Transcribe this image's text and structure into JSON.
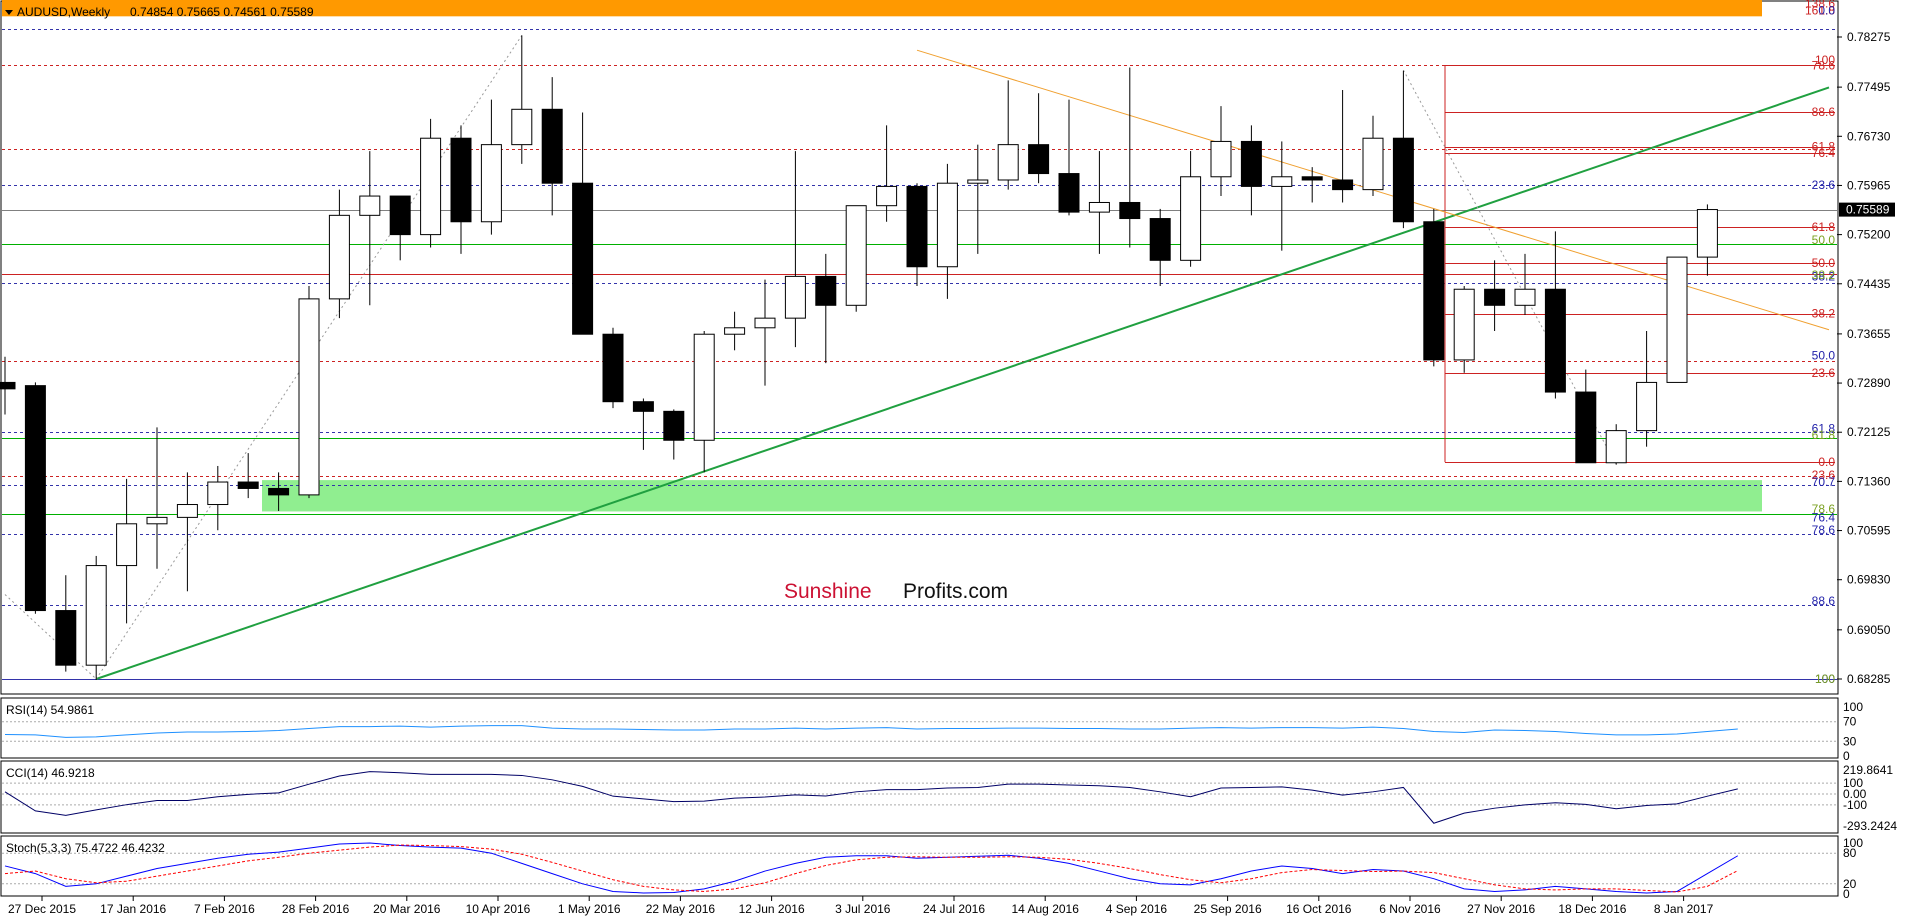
{
  "chart_data": [
    {
      "type": "candlestick",
      "symbol_header": {
        "symbol": "AUDUSD,Weekly",
        "ohlc": "0.74854 0.75665 0.74561 0.75589"
      },
      "current_price": "0.75589",
      "y_ticks": [
        "0.78275",
        "0.77495",
        "0.76730",
        "0.75965",
        "0.75200",
        "0.74435",
        "0.73655",
        "0.72890",
        "0.72125",
        "0.71360",
        "0.70595",
        "0.69830",
        "0.69050",
        "0.68285"
      ],
      "x_labels": [
        "27 Dec 2015",
        "17 Jan 2016",
        "7 Feb 2016",
        "28 Feb 2016",
        "20 Mar 2016",
        "10 Apr 2016",
        "1 May 2016",
        "22 May 2016",
        "12 Jun 2016",
        "3 Jul 2016",
        "24 Jul 2016",
        "14 Aug 2016",
        "4 Sep 2016",
        "25 Sep 2016",
        "16 Oct 2016",
        "6 Nov 2016",
        "27 Nov 2016",
        "18 Dec 2016",
        "8 Jan 2017"
      ],
      "watermark": {
        "part1": "Sunshine",
        "part2": "Profits.com"
      },
      "candles": [
        {
          "o": 0.729,
          "h": 0.733,
          "l": 0.724,
          "c": 0.728
        },
        {
          "o": 0.7285,
          "h": 0.729,
          "l": 0.693,
          "c": 0.6935
        },
        {
          "o": 0.6935,
          "h": 0.699,
          "l": 0.684,
          "c": 0.685
        },
        {
          "o": 0.685,
          "h": 0.702,
          "l": 0.6827,
          "c": 0.7005
        },
        {
          "o": 0.7005,
          "h": 0.714,
          "l": 0.6915,
          "c": 0.707
        },
        {
          "o": 0.707,
          "h": 0.722,
          "l": 0.7,
          "c": 0.708
        },
        {
          "o": 0.708,
          "h": 0.715,
          "l": 0.6965,
          "c": 0.71
        },
        {
          "o": 0.71,
          "h": 0.716,
          "l": 0.706,
          "c": 0.7135
        },
        {
          "o": 0.7135,
          "h": 0.718,
          "l": 0.711,
          "c": 0.7125
        },
        {
          "o": 0.7125,
          "h": 0.715,
          "l": 0.709,
          "c": 0.7115
        },
        {
          "o": 0.7115,
          "h": 0.744,
          "l": 0.711,
          "c": 0.742
        },
        {
          "o": 0.742,
          "h": 0.759,
          "l": 0.739,
          "c": 0.755
        },
        {
          "o": 0.755,
          "h": 0.765,
          "l": 0.741,
          "c": 0.758
        },
        {
          "o": 0.758,
          "h": 0.758,
          "l": 0.748,
          "c": 0.752
        },
        {
          "o": 0.752,
          "h": 0.77,
          "l": 0.75,
          "c": 0.767
        },
        {
          "o": 0.767,
          "h": 0.769,
          "l": 0.749,
          "c": 0.754
        },
        {
          "o": 0.754,
          "h": 0.773,
          "l": 0.752,
          "c": 0.766
        },
        {
          "o": 0.766,
          "h": 0.783,
          "l": 0.763,
          "c": 0.7715
        },
        {
          "o": 0.7715,
          "h": 0.7765,
          "l": 0.755,
          "c": 0.76
        },
        {
          "o": 0.76,
          "h": 0.771,
          "l": 0.738,
          "c": 0.7365
        },
        {
          "o": 0.7365,
          "h": 0.7375,
          "l": 0.725,
          "c": 0.726
        },
        {
          "o": 0.726,
          "h": 0.7265,
          "l": 0.7185,
          "c": 0.7245
        },
        {
          "o": 0.7245,
          "h": 0.7248,
          "l": 0.717,
          "c": 0.72
        },
        {
          "o": 0.72,
          "h": 0.737,
          "l": 0.715,
          "c": 0.7365
        },
        {
          "o": 0.7365,
          "h": 0.74,
          "l": 0.734,
          "c": 0.7375
        },
        {
          "o": 0.7375,
          "h": 0.745,
          "l": 0.7285,
          "c": 0.739
        },
        {
          "o": 0.739,
          "h": 0.765,
          "l": 0.7345,
          "c": 0.7455
        },
        {
          "o": 0.7455,
          "h": 0.749,
          "l": 0.732,
          "c": 0.741
        },
        {
          "o": 0.741,
          "h": 0.756,
          "l": 0.74,
          "c": 0.7565
        },
        {
          "o": 0.7565,
          "h": 0.769,
          "l": 0.754,
          "c": 0.7595
        },
        {
          "o": 0.7595,
          "h": 0.76,
          "l": 0.744,
          "c": 0.747
        },
        {
          "o": 0.747,
          "h": 0.763,
          "l": 0.742,
          "c": 0.76
        },
        {
          "o": 0.76,
          "h": 0.766,
          "l": 0.749,
          "c": 0.7605
        },
        {
          "o": 0.7605,
          "h": 0.776,
          "l": 0.759,
          "c": 0.766
        },
        {
          "o": 0.766,
          "h": 0.774,
          "l": 0.76,
          "c": 0.7615
        },
        {
          "o": 0.7615,
          "h": 0.773,
          "l": 0.755,
          "c": 0.7555
        },
        {
          "o": 0.7555,
          "h": 0.765,
          "l": 0.749,
          "c": 0.757
        },
        {
          "o": 0.757,
          "h": 0.778,
          "l": 0.75,
          "c": 0.7545
        },
        {
          "o": 0.7545,
          "h": 0.756,
          "l": 0.744,
          "c": 0.748
        },
        {
          "o": 0.748,
          "h": 0.765,
          "l": 0.747,
          "c": 0.761
        },
        {
          "o": 0.761,
          "h": 0.772,
          "l": 0.758,
          "c": 0.7665
        },
        {
          "o": 0.7665,
          "h": 0.769,
          "l": 0.755,
          "c": 0.7595
        },
        {
          "o": 0.7595,
          "h": 0.7665,
          "l": 0.7495,
          "c": 0.761
        },
        {
          "o": 0.761,
          "h": 0.7625,
          "l": 0.757,
          "c": 0.7605
        },
        {
          "o": 0.7605,
          "h": 0.7745,
          "l": 0.757,
          "c": 0.759
        },
        {
          "o": 0.759,
          "h": 0.7705,
          "l": 0.758,
          "c": 0.767
        },
        {
          "o": 0.767,
          "h": 0.7775,
          "l": 0.753,
          "c": 0.754
        },
        {
          "o": 0.754,
          "h": 0.756,
          "l": 0.7315,
          "c": 0.7325
        },
        {
          "o": 0.7325,
          "h": 0.744,
          "l": 0.7305,
          "c": 0.7435
        },
        {
          "o": 0.7435,
          "h": 0.748,
          "l": 0.737,
          "c": 0.741
        },
        {
          "o": 0.741,
          "h": 0.749,
          "l": 0.7395,
          "c": 0.7435
        },
        {
          "o": 0.7435,
          "h": 0.7525,
          "l": 0.7265,
          "c": 0.7275
        },
        {
          "o": 0.7275,
          "h": 0.731,
          "l": 0.7165,
          "c": 0.7165
        },
        {
          "o": 0.7165,
          "h": 0.7225,
          "l": 0.7162,
          "c": 0.7215
        },
        {
          "o": 0.7215,
          "h": 0.737,
          "l": 0.719,
          "c": 0.729
        },
        {
          "o": 0.729,
          "h": 0.7485,
          "l": 0.729,
          "c": 0.7485
        },
        {
          "o": 0.7485,
          "h": 0.7567,
          "l": 0.7456,
          "c": 0.7559
        }
      ],
      "levels": [
        {
          "price": 0.75589,
          "color": "#808080",
          "style": "solid"
        },
        {
          "price": 0.784,
          "color": "#3333aa",
          "style": "dashed"
        },
        {
          "price": 0.7784,
          "color": "#cc2222",
          "style": "dashed"
        },
        {
          "price": 0.7653,
          "color": "#cc2222",
          "style": "dashed"
        },
        {
          "price": 0.75975,
          "color": "#3333aa",
          "style": "dashed"
        },
        {
          "price": 0.7505,
          "color": "#00b000",
          "style": "solid"
        },
        {
          "price": 0.7459,
          "color": "#cc2222",
          "style": "solid"
        },
        {
          "price": 0.7444,
          "color": "#3333aa",
          "style": "dashed"
        },
        {
          "price": 0.7323,
          "color": "#cc2222",
          "style": "dashed"
        },
        {
          "price": 0.72125,
          "color": "#3333aa",
          "style": "dashed"
        },
        {
          "price": 0.7204,
          "color": "#00b000",
          "style": "solid"
        },
        {
          "price": 0.7145,
          "color": "#cc2222",
          "style": "dashed"
        },
        {
          "price": 0.7131,
          "color": "#3333aa",
          "style": "dashed"
        },
        {
          "price": 0.7086,
          "color": "#00b000",
          "style": "solid"
        },
        {
          "price": 0.7054,
          "color": "#3333aa",
          "style": "dashed"
        },
        {
          "price": 0.6943,
          "color": "#3333aa",
          "style": "dashed"
        },
        {
          "price": 0.68285,
          "color": "#3333aa",
          "style": "solid"
        }
      ],
      "fib_levels_red": [
        "0.0",
        "23.6",
        "38.2",
        "50.0",
        "61.8",
        "76.4",
        "78.6",
        "88.6",
        "100",
        "123.6",
        "161.8"
      ],
      "fib_labels_red": [
        {
          "text": "138.6",
          "price": 0.788
        },
        {
          "text": "161.8",
          "price": 0.7869
        },
        {
          "text": "100",
          "price": 0.7792
        },
        {
          "text": "78.6",
          "price": 0.7783
        },
        {
          "text": "88.6",
          "price": 0.7711
        },
        {
          "text": "61.8",
          "price": 0.7657
        },
        {
          "text": "76.4",
          "price": 0.7647
        },
        {
          "text": "61.8",
          "price": 0.7532
        },
        {
          "text": "50.0",
          "price": 0.7476
        },
        {
          "text": "38.2",
          "price": 0.7397
        },
        {
          "text": "23.6",
          "price": 0.7305
        },
        {
          "text": "0.0",
          "price": 0.7166
        },
        {
          "text": "23.6",
          "price": 0.7146
        }
      ],
      "fib_labels_blue": [
        {
          "text": "0.0",
          "price": 0.7869
        },
        {
          "text": "23.6",
          "price": 0.7597
        },
        {
          "text": "38.2",
          "price": 0.7455
        },
        {
          "text": "50.0",
          "price": 0.7332
        },
        {
          "text": "61.8",
          "price": 0.7218
        },
        {
          "text": "70.7",
          "price": 0.7135
        },
        {
          "text": "76.4",
          "price": 0.708
        },
        {
          "text": "78.6",
          "price": 0.706
        },
        {
          "text": "88.6",
          "price": 0.695
        },
        {
          "text": "100",
          "price": 0.68285
        }
      ],
      "fib_labels_green": [
        {
          "text": "50.0",
          "price": 0.7512
        },
        {
          "text": "38.2",
          "price": 0.7457
        },
        {
          "text": "61.8",
          "price": 0.7208
        },
        {
          "text": "78.6",
          "price": 0.7093
        },
        {
          "text": "100",
          "price": 0.68285
        }
      ],
      "resistance_zone": {
        "top": 0.7888,
        "bottom": 0.7869,
        "color": "#ff9900"
      },
      "support_zone": {
        "top": 0.7138,
        "bottom": 0.7111,
        "color": "#90ee90"
      },
      "trendlines": [
        {
          "color": "#20a040",
          "from": {
            "i": 3,
            "p": 0.68285
          },
          "to": {
            "i": 60,
            "p": 0.7749
          }
        },
        {
          "color": "#f0a030",
          "from": {
            "i": 30,
            "p": 0.7807
          },
          "to": {
            "i": 60,
            "p": 0.7372
          }
        }
      ]
    },
    {
      "type": "line",
      "label": "RSI(14) 54.9861",
      "y_ticks": [
        "100",
        "70",
        "30",
        "0"
      ],
      "ylim": [
        0,
        100
      ],
      "values": [
        44,
        43,
        38,
        39,
        43,
        47,
        49,
        49,
        50,
        52,
        56,
        60,
        60,
        61,
        59,
        61,
        62,
        62,
        57,
        55,
        55,
        54,
        53,
        53,
        55,
        55,
        57,
        55,
        57,
        58,
        55,
        56,
        56,
        57,
        57,
        56,
        56,
        55,
        55,
        57,
        58,
        57,
        58,
        58,
        57,
        59,
        56,
        50,
        48,
        53,
        52,
        50,
        46,
        43,
        43,
        45,
        50,
        55
      ]
    },
    {
      "type": "line",
      "label": "CCI(14) 46.9218",
      "y_ticks": [
        "219.8641",
        "100",
        "0.00",
        "-100",
        "-293.2424"
      ],
      "ylim": [
        -293.2424,
        219.8641
      ],
      "values": [
        20,
        -155,
        -196,
        -145,
        -98,
        -60,
        -60,
        -25,
        -3,
        10,
        90,
        165,
        205,
        195,
        180,
        180,
        180,
        170,
        130,
        70,
        -20,
        -45,
        -70,
        -65,
        -38,
        -28,
        -8,
        -18,
        20,
        40,
        40,
        55,
        60,
        90,
        90,
        82,
        75,
        60,
        20,
        -25,
        55,
        60,
        65,
        35,
        -10,
        20,
        60,
        -268,
        -175,
        -130,
        -100,
        -80,
        -95,
        -135,
        -105,
        -90,
        -20,
        47
      ]
    },
    {
      "type": "line",
      "label": "Stoch(5,3,3) 75.4722 46.4232",
      "y_ticks": [
        "100",
        "80",
        "20",
        "0"
      ],
      "ylim": [
        0,
        100
      ],
      "series": [
        {
          "name": "Stoch main",
          "color": "#0000ff",
          "values": [
            55,
            40,
            15,
            20,
            35,
            50,
            60,
            70,
            78,
            82,
            90,
            98,
            100,
            95,
            92,
            90,
            80,
            60,
            40,
            20,
            5,
            2,
            3,
            10,
            25,
            45,
            60,
            72,
            75,
            75,
            70,
            72,
            74,
            76,
            70,
            60,
            45,
            30,
            20,
            18,
            30,
            45,
            55,
            50,
            40,
            48,
            45,
            30,
            10,
            5,
            8,
            15,
            10,
            5,
            2,
            5,
            40,
            75
          ]
        },
        {
          "name": "Stoch signal",
          "color": "#ff0000",
          "values": [
            40,
            45,
            30,
            22,
            25,
            35,
            45,
            55,
            65,
            72,
            80,
            86,
            92,
            96,
            95,
            93,
            88,
            78,
            62,
            45,
            28,
            15,
            8,
            5,
            10,
            22,
            40,
            56,
            67,
            72,
            73,
            72,
            72,
            73,
            72,
            68,
            60,
            50,
            38,
            28,
            22,
            30,
            42,
            48,
            46,
            44,
            45,
            42,
            30,
            18,
            10,
            8,
            10,
            10,
            7,
            4,
            15,
            46
          ]
        }
      ]
    }
  ]
}
